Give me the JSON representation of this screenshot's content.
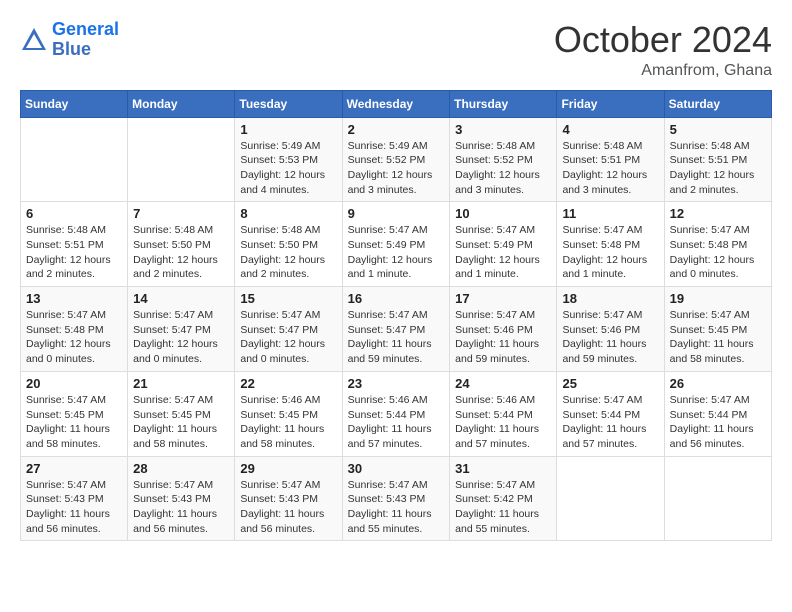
{
  "logo": {
    "line1": "General",
    "line2": "Blue"
  },
  "title": "October 2024",
  "location": "Amanfrom, Ghana",
  "days_of_week": [
    "Sunday",
    "Monday",
    "Tuesday",
    "Wednesday",
    "Thursday",
    "Friday",
    "Saturday"
  ],
  "weeks": [
    [
      {
        "day": "",
        "info": ""
      },
      {
        "day": "",
        "info": ""
      },
      {
        "day": "1",
        "info": "Sunrise: 5:49 AM\nSunset: 5:53 PM\nDaylight: 12 hours and 4 minutes."
      },
      {
        "day": "2",
        "info": "Sunrise: 5:49 AM\nSunset: 5:52 PM\nDaylight: 12 hours and 3 minutes."
      },
      {
        "day": "3",
        "info": "Sunrise: 5:48 AM\nSunset: 5:52 PM\nDaylight: 12 hours and 3 minutes."
      },
      {
        "day": "4",
        "info": "Sunrise: 5:48 AM\nSunset: 5:51 PM\nDaylight: 12 hours and 3 minutes."
      },
      {
        "day": "5",
        "info": "Sunrise: 5:48 AM\nSunset: 5:51 PM\nDaylight: 12 hours and 2 minutes."
      }
    ],
    [
      {
        "day": "6",
        "info": "Sunrise: 5:48 AM\nSunset: 5:51 PM\nDaylight: 12 hours and 2 minutes."
      },
      {
        "day": "7",
        "info": "Sunrise: 5:48 AM\nSunset: 5:50 PM\nDaylight: 12 hours and 2 minutes."
      },
      {
        "day": "8",
        "info": "Sunrise: 5:48 AM\nSunset: 5:50 PM\nDaylight: 12 hours and 2 minutes."
      },
      {
        "day": "9",
        "info": "Sunrise: 5:47 AM\nSunset: 5:49 PM\nDaylight: 12 hours and 1 minute."
      },
      {
        "day": "10",
        "info": "Sunrise: 5:47 AM\nSunset: 5:49 PM\nDaylight: 12 hours and 1 minute."
      },
      {
        "day": "11",
        "info": "Sunrise: 5:47 AM\nSunset: 5:48 PM\nDaylight: 12 hours and 1 minute."
      },
      {
        "day": "12",
        "info": "Sunrise: 5:47 AM\nSunset: 5:48 PM\nDaylight: 12 hours and 0 minutes."
      }
    ],
    [
      {
        "day": "13",
        "info": "Sunrise: 5:47 AM\nSunset: 5:48 PM\nDaylight: 12 hours and 0 minutes."
      },
      {
        "day": "14",
        "info": "Sunrise: 5:47 AM\nSunset: 5:47 PM\nDaylight: 12 hours and 0 minutes."
      },
      {
        "day": "15",
        "info": "Sunrise: 5:47 AM\nSunset: 5:47 PM\nDaylight: 12 hours and 0 minutes."
      },
      {
        "day": "16",
        "info": "Sunrise: 5:47 AM\nSunset: 5:47 PM\nDaylight: 11 hours and 59 minutes."
      },
      {
        "day": "17",
        "info": "Sunrise: 5:47 AM\nSunset: 5:46 PM\nDaylight: 11 hours and 59 minutes."
      },
      {
        "day": "18",
        "info": "Sunrise: 5:47 AM\nSunset: 5:46 PM\nDaylight: 11 hours and 59 minutes."
      },
      {
        "day": "19",
        "info": "Sunrise: 5:47 AM\nSunset: 5:45 PM\nDaylight: 11 hours and 58 minutes."
      }
    ],
    [
      {
        "day": "20",
        "info": "Sunrise: 5:47 AM\nSunset: 5:45 PM\nDaylight: 11 hours and 58 minutes."
      },
      {
        "day": "21",
        "info": "Sunrise: 5:47 AM\nSunset: 5:45 PM\nDaylight: 11 hours and 58 minutes."
      },
      {
        "day": "22",
        "info": "Sunrise: 5:46 AM\nSunset: 5:45 PM\nDaylight: 11 hours and 58 minutes."
      },
      {
        "day": "23",
        "info": "Sunrise: 5:46 AM\nSunset: 5:44 PM\nDaylight: 11 hours and 57 minutes."
      },
      {
        "day": "24",
        "info": "Sunrise: 5:46 AM\nSunset: 5:44 PM\nDaylight: 11 hours and 57 minutes."
      },
      {
        "day": "25",
        "info": "Sunrise: 5:47 AM\nSunset: 5:44 PM\nDaylight: 11 hours and 57 minutes."
      },
      {
        "day": "26",
        "info": "Sunrise: 5:47 AM\nSunset: 5:44 PM\nDaylight: 11 hours and 56 minutes."
      }
    ],
    [
      {
        "day": "27",
        "info": "Sunrise: 5:47 AM\nSunset: 5:43 PM\nDaylight: 11 hours and 56 minutes."
      },
      {
        "day": "28",
        "info": "Sunrise: 5:47 AM\nSunset: 5:43 PM\nDaylight: 11 hours and 56 minutes."
      },
      {
        "day": "29",
        "info": "Sunrise: 5:47 AM\nSunset: 5:43 PM\nDaylight: 11 hours and 56 minutes."
      },
      {
        "day": "30",
        "info": "Sunrise: 5:47 AM\nSunset: 5:43 PM\nDaylight: 11 hours and 55 minutes."
      },
      {
        "day": "31",
        "info": "Sunrise: 5:47 AM\nSunset: 5:42 PM\nDaylight: 11 hours and 55 minutes."
      },
      {
        "day": "",
        "info": ""
      },
      {
        "day": "",
        "info": ""
      }
    ]
  ]
}
